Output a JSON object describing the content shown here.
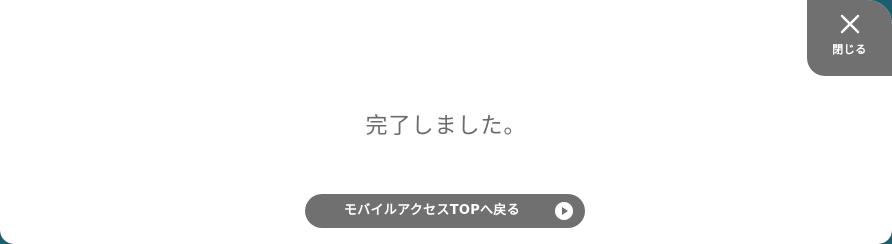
{
  "dialog": {
    "message": "完了しました。",
    "close_label": "閉じる",
    "back_label": "モバイルアクセスTOPへ戻る",
    "close_icon": "close-icon",
    "back_icon": "play-circle-icon"
  },
  "colors": {
    "backdrop": "#1b5f6e",
    "panel": "#ffffff",
    "button": "#707070",
    "message_text": "#6b6b6b"
  }
}
